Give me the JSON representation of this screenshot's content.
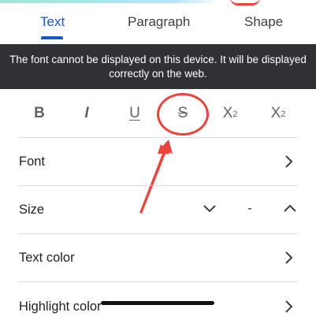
{
  "tabs": [
    {
      "label": "Text",
      "active": true
    },
    {
      "label": "Paragraph",
      "active": false
    },
    {
      "label": "Shape",
      "active": false
    }
  ],
  "toast": {
    "message": "The font  cannot be displayed on this device. It will be displayed correctly on the web."
  },
  "format_buttons": {
    "bold": "B",
    "italic": "I",
    "underline": "U",
    "strikethrough": "S",
    "superscript": "X",
    "superscript_mark": "2",
    "subscript": "X",
    "subscript_mark": "2"
  },
  "rows": {
    "font": "Font",
    "size": "Size",
    "size_value": "-",
    "text_color": "Text color",
    "highlight_color": "Highlight color"
  },
  "colors": {
    "accent": "#1a56c9",
    "annotation": "#e8453c",
    "toast_bg": "#303134",
    "divider": "#dadce0"
  },
  "icons": [
    "chevron-right-icon",
    "chevron-down-icon",
    "chevron-up-icon"
  ]
}
